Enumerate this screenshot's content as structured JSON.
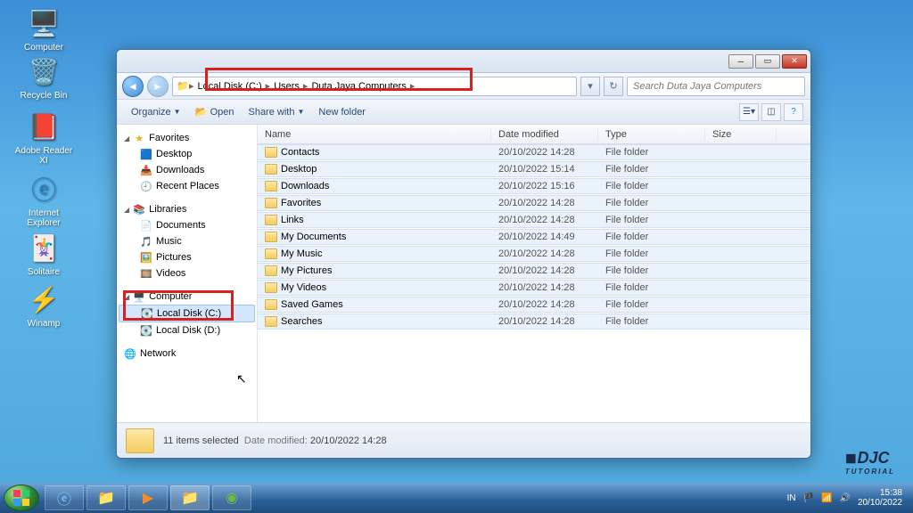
{
  "desktop": [
    {
      "name": "Computer",
      "icon": "🖥️"
    },
    {
      "name": "Recycle Bin",
      "icon": "🗑️"
    },
    {
      "name": "Adobe Reader XI",
      "icon": "📕"
    },
    {
      "name": "Internet Explorer",
      "icon": "🌐"
    },
    {
      "name": "Solitaire",
      "icon": "🃏"
    },
    {
      "name": "Winamp",
      "icon": "🔶"
    }
  ],
  "breadcrumb": [
    "Local Disk (C:)",
    "Users",
    "Duta Jaya Computers"
  ],
  "search_placeholder": "Search Duta Jaya Computers",
  "toolbar": {
    "organize": "Organize",
    "open": "Open",
    "share": "Share with",
    "newfolder": "New folder"
  },
  "sidebar": {
    "favorites": {
      "label": "Favorites",
      "items": [
        "Desktop",
        "Downloads",
        "Recent Places"
      ]
    },
    "libraries": {
      "label": "Libraries",
      "items": [
        "Documents",
        "Music",
        "Pictures",
        "Videos"
      ]
    },
    "computer": {
      "label": "Computer",
      "items": [
        "Local Disk (C:)",
        "Local Disk (D:)"
      ]
    },
    "network": {
      "label": "Network"
    }
  },
  "columns": {
    "name": "Name",
    "date": "Date modified",
    "type": "Type",
    "size": "Size"
  },
  "files": [
    {
      "name": "Contacts",
      "date": "20/10/2022 14:28",
      "type": "File folder"
    },
    {
      "name": "Desktop",
      "date": "20/10/2022 15:14",
      "type": "File folder"
    },
    {
      "name": "Downloads",
      "date": "20/10/2022 15:16",
      "type": "File folder"
    },
    {
      "name": "Favorites",
      "date": "20/10/2022 14:28",
      "type": "File folder"
    },
    {
      "name": "Links",
      "date": "20/10/2022 14:28",
      "type": "File folder"
    },
    {
      "name": "My Documents",
      "date": "20/10/2022 14:49",
      "type": "File folder"
    },
    {
      "name": "My Music",
      "date": "20/10/2022 14:28",
      "type": "File folder"
    },
    {
      "name": "My Pictures",
      "date": "20/10/2022 14:28",
      "type": "File folder"
    },
    {
      "name": "My Videos",
      "date": "20/10/2022 14:28",
      "type": "File folder"
    },
    {
      "name": "Saved Games",
      "date": "20/10/2022 14:28",
      "type": "File folder"
    },
    {
      "name": "Searches",
      "date": "20/10/2022 14:28",
      "type": "File folder"
    }
  ],
  "status": {
    "sel": "11 items selected",
    "date_label": "Date modified:",
    "date_value": "20/10/2022 14:28"
  },
  "tray": {
    "lang": "IN",
    "time": "15:38",
    "date": "20/10/2022"
  },
  "logo": {
    "text": "DJC",
    "sub": "TUTORIAL"
  }
}
